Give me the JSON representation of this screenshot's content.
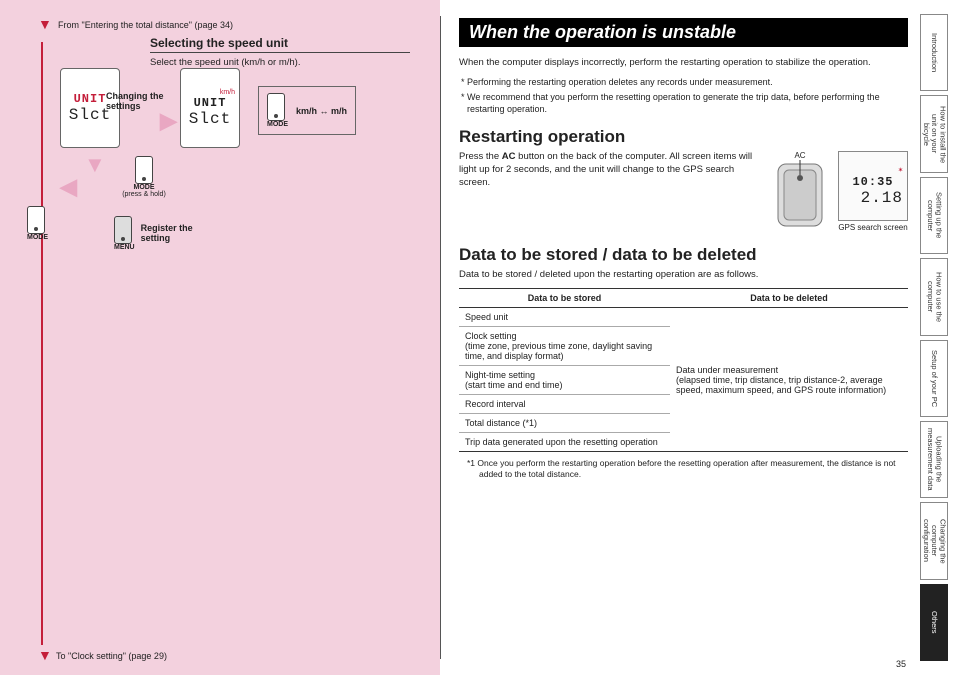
{
  "left": {
    "from": "From \"Entering the total distance\" (page 34)",
    "section_title": "Selecting the speed unit",
    "section_body": "Select the speed unit (km/h or m/h).",
    "unit_display1": "UNIT",
    "unit_select": "Slct",
    "mode": "MODE",
    "press_hold": "(press & hold)",
    "changing": "Changing the settings",
    "speed_toggle": "km/h ↔ m/h",
    "register": "Register the setting",
    "menu": "MENU",
    "to": "To \"Clock setting\" (page 29)"
  },
  "right": {
    "heading_black": "When the operation is unstable",
    "intro": "When the computer displays incorrectly, perform the restarting operation to stabilize the operation.",
    "bullet1": "* Performing the restarting operation deletes any records under measurement.",
    "bullet2": "* We recommend that you perform the resetting operation to generate the trip data, before performing the restarting operation.",
    "h2a": "Restarting operation",
    "restart_text": "Press the AC button on the back of the computer. All screen items will light up for 2 seconds, and the unit will change to the GPS search screen.",
    "ac": "AC",
    "gps_time": "10:35",
    "gps_dist": "2.18",
    "gps_caption": "GPS search screen",
    "h2b": "Data to be stored / data to be deleted",
    "h2b_sub": "Data to be stored / deleted upon the restarting operation are as follows.",
    "col_stored": "Data to be stored",
    "col_deleted": "Data to be deleted",
    "stored": [
      "Speed unit",
      "Clock setting\n(time zone, previous time zone, daylight saving time, and display format)",
      "Night-time setting\n(start time and end time)",
      "Record interval",
      "Total distance (*1)",
      "Trip data generated upon the resetting operation"
    ],
    "deleted": "Data under measurement\n(elapsed time, trip distance, trip distance-2, average speed, maximum speed, and GPS route information)",
    "footnote": "*1 Once you perform the restarting operation before the resetting operation after measurement, the distance is not added to the total distance.",
    "page_num": "35"
  },
  "tabs": [
    {
      "label": "Introduction",
      "active": false
    },
    {
      "label": "How to install the unit on your bicycle",
      "active": false
    },
    {
      "label": "Setting up the computer",
      "active": false
    },
    {
      "label": "How to use the computer",
      "active": false
    },
    {
      "label": "Setup of your PC",
      "active": false
    },
    {
      "label": "Uploading the measurement data",
      "active": false
    },
    {
      "label": "Changing the computer configuration",
      "active": false
    },
    {
      "label": "Others",
      "active": true
    }
  ]
}
